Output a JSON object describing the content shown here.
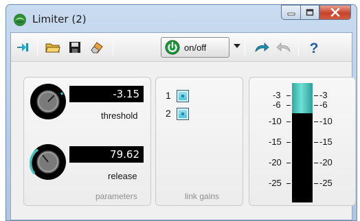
{
  "window": {
    "title": "Limiter (2)",
    "caption_buttons": [
      "minimize-icon",
      "maximize-icon",
      "close-icon"
    ]
  },
  "toolbar": {
    "items": [
      "pin-icon",
      "open-folder-icon",
      "save-disk-icon",
      "eraser-icon",
      "undo-arrow-icon",
      "redo-arrow-icon",
      "help-icon"
    ],
    "power_label": "on/off",
    "power_icon": "power-icon"
  },
  "parameters": {
    "caption": "parameters",
    "threshold": {
      "value": "-3.15",
      "label": "threshold"
    },
    "release": {
      "value": "79.62",
      "label": "release"
    }
  },
  "link_gains": {
    "caption": "link gains",
    "channels": [
      {
        "number": "1"
      },
      {
        "number": "2"
      }
    ]
  },
  "meter": {
    "left_scale": [
      "-3",
      "-6",
      "-10",
      "-15",
      "-20",
      "-25"
    ],
    "right_scale": [
      "-3",
      "-6",
      "-10",
      "-15",
      "-20",
      "-25"
    ],
    "gain_reduction_db": 3
  },
  "colors": {
    "accent": "#3fc6c0",
    "meter_bg": "#000000",
    "title_bar": "#b7cde6"
  }
}
